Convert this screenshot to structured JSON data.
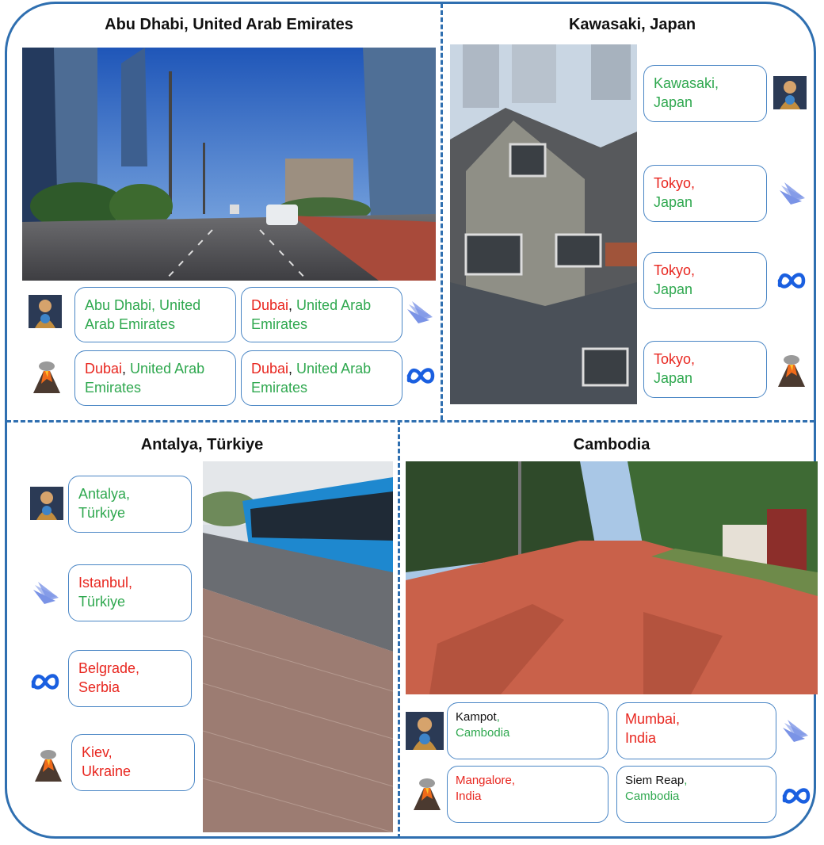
{
  "panels": {
    "abu_dhabi": {
      "title": "Abu Dhabi, United Arab Emirates",
      "answers": [
        {
          "model": "gemini-style-icon",
          "place": "",
          "country": "Abu Dhabi, United Arab Emirates",
          "place_color": "green"
        },
        {
          "model": "layers-icon",
          "place": "Dubai",
          "sep": ",",
          "country": " United Arab Emirates"
        },
        {
          "model": "volcano-icon",
          "place": "Dubai",
          "sep": ",",
          "country": " United Arab Emirates"
        },
        {
          "model": "meta-icon",
          "place": "Dubai",
          "sep": ",",
          "country": " United Arab Emirates"
        }
      ]
    },
    "kawasaki": {
      "title": "Kawasaki, Japan",
      "answers": [
        {
          "model": "gemini-style-icon",
          "place": "Kawasaki,",
          "country": "Japan",
          "place_color": "green"
        },
        {
          "model": "layers-icon",
          "place": "Tokyo,",
          "country": "Japan",
          "place_color": "red"
        },
        {
          "model": "meta-icon",
          "place": "Tokyo,",
          "country": "Japan",
          "place_color": "red"
        },
        {
          "model": "volcano-icon",
          "place": "Tokyo,",
          "country": "Japan",
          "place_color": "red"
        }
      ]
    },
    "antalya": {
      "title": "Antalya, Türkiye",
      "answers": [
        {
          "model": "gemini-style-icon",
          "place": "Antalya,",
          "country": "Türkiye",
          "place_color": "green",
          "country_color": "green"
        },
        {
          "model": "layers-icon",
          "place": "Istanbul,",
          "country": "Türkiye",
          "place_color": "red",
          "country_color": "green"
        },
        {
          "model": "meta-icon",
          "place": "Belgrade,",
          "country": "Serbia",
          "place_color": "red",
          "country_color": "red"
        },
        {
          "model": "volcano-icon",
          "place": "Kiev,",
          "country": "Ukraine",
          "place_color": "red",
          "country_color": "red"
        }
      ]
    },
    "cambodia": {
      "title": "Cambodia",
      "answers": [
        {
          "model": "gemini-style-icon",
          "place": "Kampot",
          "sep": ",",
          "country": "Cambodia",
          "place_color": "black",
          "country_color": "green"
        },
        {
          "model": "layers-icon",
          "place": "Mumbai,",
          "country": "India",
          "place_color": "red",
          "country_color": "red"
        },
        {
          "model": "volcano-icon",
          "place": "Mangalore,",
          "country": "India",
          "place_color": "red",
          "country_color": "red"
        },
        {
          "model": "meta-icon",
          "place": "Siem Reap",
          "sep": ",",
          "country": "Cambodia",
          "place_color": "black",
          "country_color": "green"
        }
      ]
    }
  },
  "colors": {
    "frame": "#2f6fb0",
    "correct": "#2fa84f",
    "incorrect": "#e8261f"
  }
}
